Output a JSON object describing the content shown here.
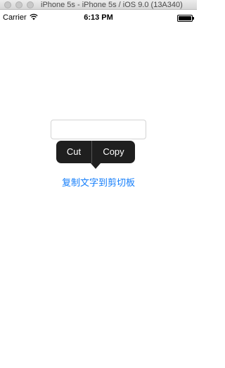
{
  "window": {
    "title": "iPhone 5s - iPhone 5s / iOS 9.0 (13A340)"
  },
  "status_bar": {
    "carrier": "Carrier",
    "time": "6:13 PM"
  },
  "text_field": {
    "value": ""
  },
  "edit_menu": {
    "items": [
      "Cut",
      "Copy"
    ]
  },
  "copy_button": {
    "label": "复制文字到剪切板"
  },
  "colors": {
    "link_blue": "#147efb",
    "menu_bg": "#1f1f1f"
  },
  "icons": [
    "wifi-icon",
    "battery-icon"
  ]
}
